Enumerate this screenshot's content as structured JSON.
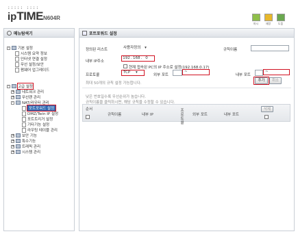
{
  "brand": {
    "dots": "::::: ::::",
    "logo_ip": "ip",
    "logo_time": "TIME",
    "logo_model": "N604R"
  },
  "top_icons": [
    {
      "label": "마시",
      "color": "#8fbf4a"
    },
    {
      "label": "재랑",
      "color": "#e8b82c"
    },
    {
      "label": "도움",
      "color": "#6aa84f"
    }
  ],
  "left_panel": {
    "title": "메뉴탐색기"
  },
  "tree": {
    "basic": "기본 설정",
    "summary": "시스템 요약 정보",
    "internet": "인터넷 연결 설정",
    "wireless_basic": "무선 설정/보안",
    "firmware": "펌웨어 업그레이드",
    "advanced": "고급 설정",
    "network": "네트워크 관리",
    "wireless": "무선랜 관리",
    "nat": "NAT/라우터 관리",
    "port_forward": "포트포워드 설정",
    "dmz": "DMZ/Twin IP 설정",
    "port_trigger": "포트트리거 설정",
    "misc": "기타기능 설정",
    "routing": "라우팅 테이블 관리",
    "security": "보안 기능",
    "special": "특수기능",
    "traffic": "트래픽 관리",
    "system": "시스템 관리"
  },
  "right_panel": {
    "title": "포트포워드 설정",
    "rule_list_label": "정의된 리스트",
    "rule_list_value": "사용자정의",
    "rule_name_label": "규칙이름",
    "rule_name_value": "",
    "internal_ip_label": "내부 IP주소",
    "ip1": "192",
    "ip2": "168",
    "ip3": "0",
    "use_current_ip": "현재 접속된 PC의 IP 주소로 설정(192.168.0.17)",
    "protocol_label": "프로토콜",
    "protocol_value": "TCP",
    "ext_port_label": "외부 포트",
    "ext_port_from": "",
    "ext_port_dash": "~",
    "ext_port_to": "",
    "int_port_label": "내부 포트",
    "int_port_from": "",
    "int_port_dash": "~",
    "int_port_to": "",
    "max_rules_note": "최대 50개의 규칙 설정 가능합니다.",
    "add_button": "추가",
    "cancel_button": "취소",
    "note_priority": "낮은 번호일수록 우선순위가 높습니다.",
    "note_click": "규칙이름을 클릭하시면, 해당 규칙을 수정할 수 있습니다.",
    "col_order": "순서",
    "col_rule_name": "규칙이름",
    "col_internal_ip": "내부 IP",
    "col_protocol": "프로토콜",
    "col_ext_port": "외부 포트",
    "col_int_port": "내부 포트",
    "col_delete": "삭제",
    "highlight_color": "#d01020",
    "selection_color": "#2f68b2"
  }
}
